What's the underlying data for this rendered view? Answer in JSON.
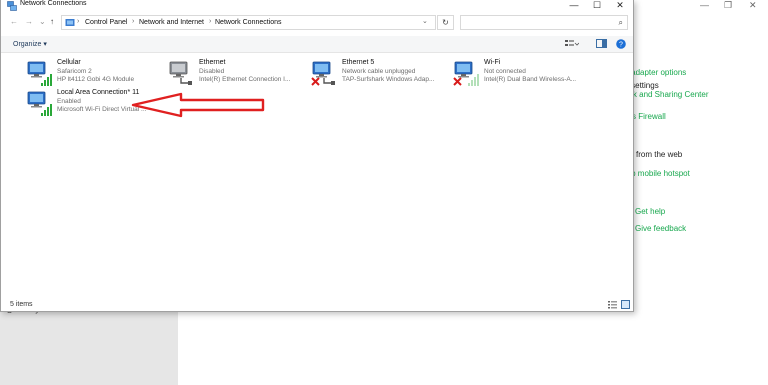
{
  "background": {
    "proxy_label": "Proxy",
    "side_panel": {
      "related_heading": "ed settings",
      "links": [
        "ge adapter options",
        "work and Sharing Center",
        "lows Firewall"
      ],
      "web_heading": "from the web",
      "web_links": [
        "g up mobile hotspot"
      ],
      "help_links": [
        "Get help",
        "Give feedback"
      ]
    }
  },
  "window": {
    "title": "Network Connections",
    "breadcrumb": [
      "Control Panel",
      "Network and Internet",
      "Network Connections"
    ],
    "search_placeholder": "",
    "organize_label": "Organize ▾"
  },
  "connections": [
    {
      "name": "Cellular",
      "status": "Safaricom 2",
      "device": "HP lt4112 Gobi 4G Module",
      "icon": "cellular-adapter-icon",
      "disconnected": false
    },
    {
      "name": "Ethernet",
      "status": "Disabled",
      "device": "Intel(R) Ethernet Connection I...",
      "icon": "ethernet-adapter-icon",
      "disconnected": false
    },
    {
      "name": "Ethernet 5",
      "status": "Network cable unplugged",
      "device": "TAP-Surfshark Windows Adap...",
      "icon": "ethernet-adapter-icon",
      "disconnected": true
    },
    {
      "name": "Wi-Fi",
      "status": "Not connected",
      "device": "Intel(R) Dual Band Wireless-A...",
      "icon": "wifi-adapter-icon",
      "disconnected": true
    },
    {
      "name": "Local Area Connection* 11",
      "status": "Enabled",
      "device": "Microsoft Wi-Fi Direct Virtual ...",
      "icon": "wifi-direct-adapter-icon",
      "disconnected": false
    }
  ],
  "status_bar": {
    "items_count": "5 items"
  },
  "colors": {
    "link_green": "#18a84e",
    "annotation_red": "#e02020",
    "selection_blue": "#1e395b"
  }
}
